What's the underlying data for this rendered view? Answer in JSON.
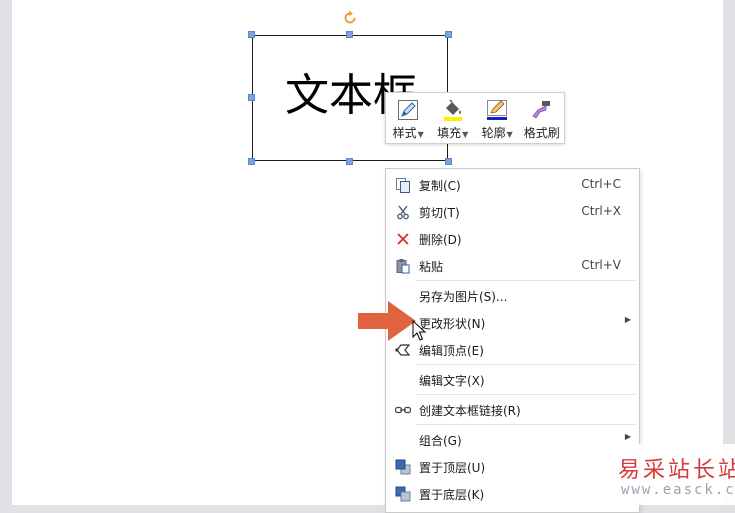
{
  "textbox": {
    "text": "文本框"
  },
  "mini_toolbar": {
    "items": [
      {
        "label": "样式",
        "icon": "style-pen-icon"
      },
      {
        "label": "填充",
        "icon": "fill-bucket-icon",
        "color": "#ffee00"
      },
      {
        "label": "轮廓",
        "icon": "outline-pencil-icon",
        "color": "#1020d0"
      },
      {
        "label": "格式刷",
        "icon": "format-painter-icon"
      }
    ]
  },
  "context_menu": {
    "items": [
      {
        "label": "复制(C)",
        "shortcut": "Ctrl+C",
        "icon": "copy-icon"
      },
      {
        "label": "剪切(T)",
        "shortcut": "Ctrl+X",
        "icon": "scissors-icon"
      },
      {
        "label": "删除(D)",
        "icon": "delete-x-icon"
      },
      {
        "label": "粘贴",
        "shortcut": "Ctrl+V",
        "icon": "paste-icon"
      },
      {
        "label": "另存为图片(S)..."
      },
      {
        "label": "更改形状(N)",
        "submenu": true
      },
      {
        "label": "编辑顶点(E)",
        "icon": "edit-points-icon"
      },
      {
        "label": "编辑文字(X)"
      },
      {
        "label": "创建文本框链接(R)",
        "icon": "link-icon"
      },
      {
        "label": "组合(G)",
        "submenu": true
      },
      {
        "label": "置于顶层(U)",
        "icon": "bring-to-front-icon"
      },
      {
        "label": "置于底层(K)",
        "icon": "send-to-back-icon"
      }
    ]
  },
  "annotation": {
    "arrow_color": "#e0623e"
  },
  "watermark": {
    "cn": "易采站长站",
    "url": "www.easck.com"
  },
  "colors": {
    "handle": "#7ba4dd",
    "rotate_handle": "#f0a030"
  }
}
